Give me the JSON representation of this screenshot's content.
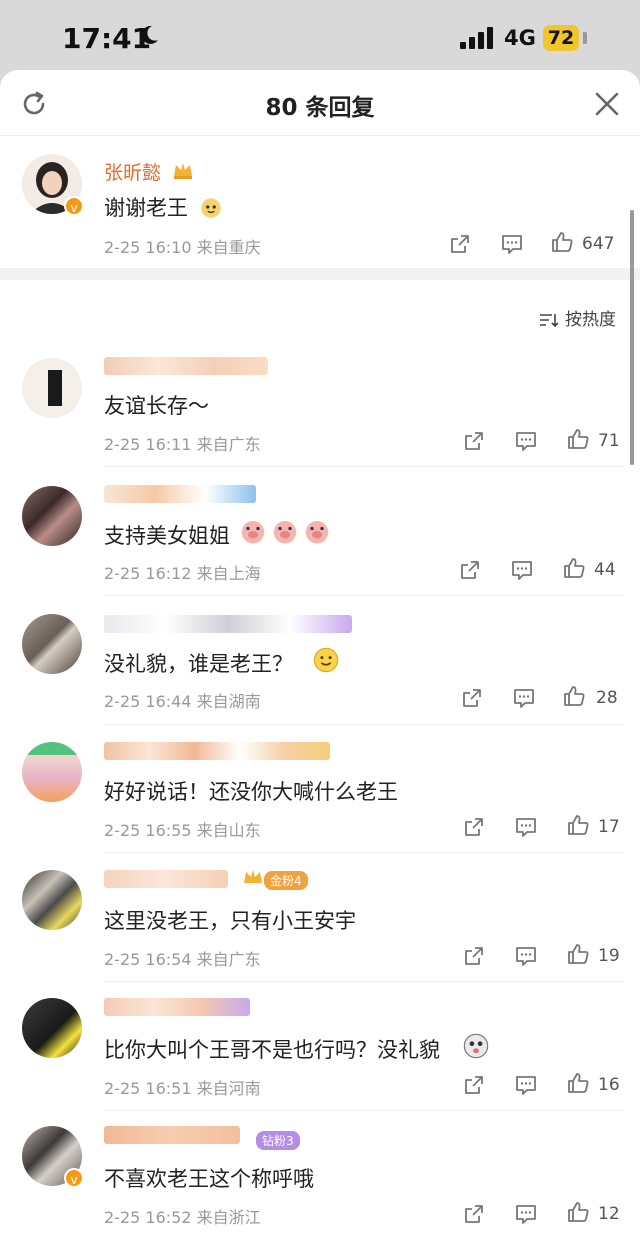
{
  "status_bar": {
    "time": "17:41",
    "network": "4G",
    "battery": "72"
  },
  "sheet": {
    "title": "80 条回复"
  },
  "main_comment": {
    "username": "张昕懿",
    "text": "谢谢老王",
    "meta": "2-25 16:10 来自重庆",
    "likes": "647"
  },
  "sort_label": "按热度",
  "replies": [
    {
      "text": "友谊长存～",
      "meta": "2-25 16:11 来自广东",
      "likes": "71"
    },
    {
      "text": "支持美女姐姐",
      "meta": "2-25 16:12 来自上海",
      "likes": "44"
    },
    {
      "text": "没礼貌，谁是老王？",
      "meta": "2-25 16:44 来自湖南",
      "likes": "28"
    },
    {
      "text": "好好说话！还没你大喊什么老王",
      "meta": "2-25 16:55 来自山东",
      "likes": "17"
    },
    {
      "text": "这里没老王，只有小王安宇",
      "meta": "2-25 16:54 来自广东",
      "likes": "19",
      "badge": "金粉4"
    },
    {
      "text": "比你大叫个王哥不是也行吗？没礼貌",
      "meta": "2-25 16:51 来自河南",
      "likes": "16"
    },
    {
      "text": "不喜欢老王这个称呼哦",
      "meta": "2-25 16:52 来自浙江",
      "likes": "12",
      "badge": "钻粉3"
    }
  ],
  "colors": {
    "username": "#e86b2c",
    "meta": "#999999",
    "accent": "#f39b17"
  }
}
